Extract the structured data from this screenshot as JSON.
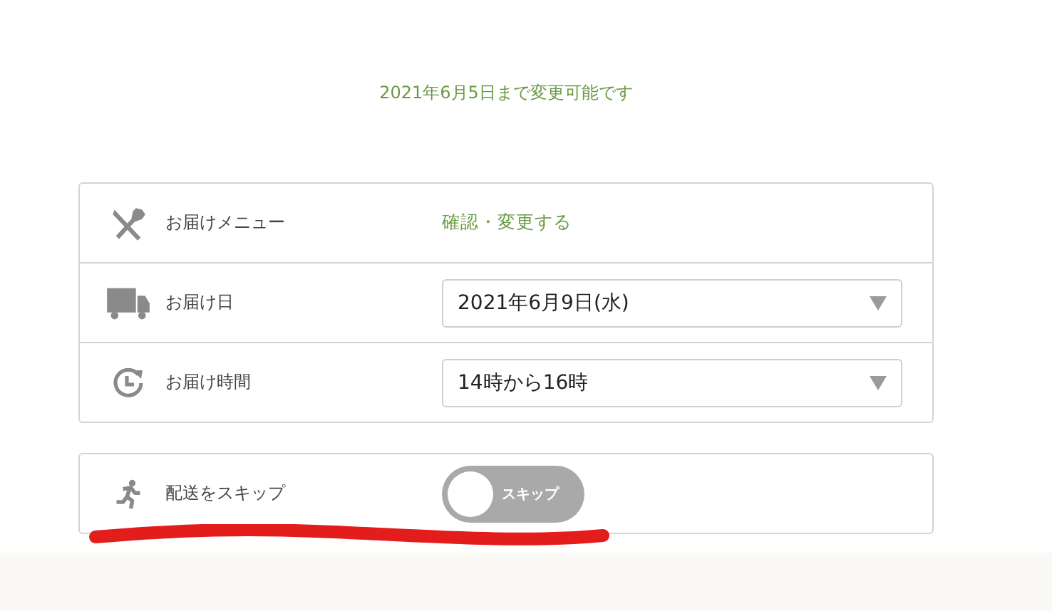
{
  "deadline_note": "2021年6月5日まで変更可能です",
  "delivery_rows": [
    {
      "kind": "link",
      "label": "お届けメニュー",
      "value": "確認・変更する"
    },
    {
      "kind": "select",
      "label": "お届け日",
      "value": "2021年6月9日(水)"
    },
    {
      "kind": "select",
      "label": "お届け時間",
      "value": "14時から16時"
    }
  ],
  "skip": {
    "label": "配送をスキップ",
    "toggle_text": "スキップ",
    "on": false
  }
}
